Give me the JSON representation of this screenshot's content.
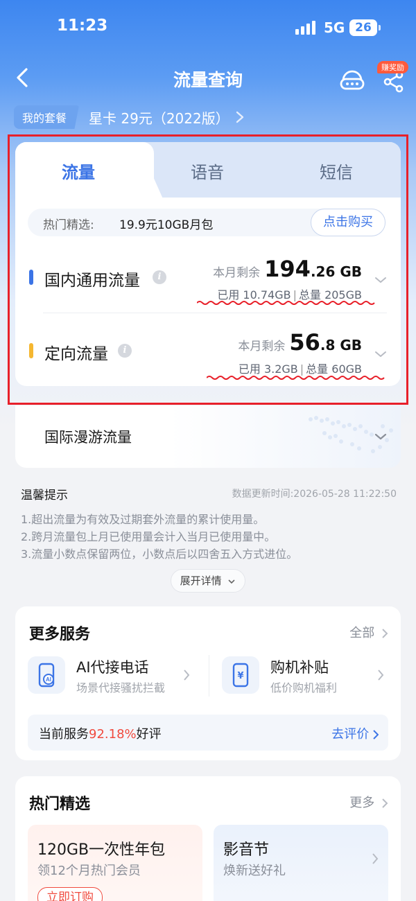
{
  "status_bar": {
    "time": "11:23",
    "network": "5G",
    "battery": "26"
  },
  "nav": {
    "title": "流量查询",
    "reward_badge": "赚奖励"
  },
  "plan": {
    "tag": "我的套餐",
    "name": "星卡 29元（2022版）"
  },
  "tabs": [
    {
      "label": "流量",
      "active": true
    },
    {
      "label": "语音",
      "active": false
    },
    {
      "label": "短信",
      "active": false
    }
  ],
  "promo": {
    "label": "热门精选:",
    "value": "19.9元10GB月包",
    "button": "点击购买"
  },
  "usage_rows": [
    {
      "title": "国内通用流量",
      "remain_label": "本月剩余",
      "remain_int": "194",
      "remain_dec": ".26 GB",
      "used": "已用 10.74GB",
      "separator": "|",
      "total": "总量 205GB",
      "indicator_color": "#3b74e6"
    },
    {
      "title": "定向流量",
      "remain_label": "本月剩余",
      "remain_int": "56",
      "remain_dec": ".8 GB",
      "used": "已用 3.2GB",
      "separator": "|",
      "total": "总量 60GB",
      "indicator_color": "#f5b731"
    }
  ],
  "roaming": {
    "title": "国际漫游流量"
  },
  "tips": {
    "title": "温馨提示",
    "update_time": "数据更新时间:2026-05-28 11:22:50",
    "lines": [
      "1.超出流量为有效及过期套外流量的累计使用量。",
      "2.跨月流量包上月已使用量会计入当月已使用量中。",
      "3.流量小数点保留两位，小数点后以四舍五入方式进位。"
    ],
    "expand": "展开详情"
  },
  "services": {
    "title": "更多服务",
    "all_link": "全部",
    "items": [
      {
        "name": "AI代接电话",
        "desc": "场景代接骚扰拦截",
        "icon": "ai-phone-icon"
      },
      {
        "name": "购机补贴",
        "desc": "低价购机福利",
        "icon": "phone-subsidy-icon"
      }
    ],
    "rating": {
      "prefix": "当前服务",
      "percent": "92.18%",
      "suffix": "好评",
      "link": "去评价"
    }
  },
  "featured": {
    "title": "热门精选",
    "more_link": "更多",
    "items": [
      {
        "title": "120GB一次性年包",
        "desc": "领12个月热门会员",
        "button": "立即订购"
      },
      {
        "title": "影音节",
        "desc": "焕新送好礼"
      }
    ]
  },
  "colors": {
    "brand_blue": "#3b74e6",
    "highlight_red": "#e8202a",
    "rating_red": "#f04a3e"
  }
}
